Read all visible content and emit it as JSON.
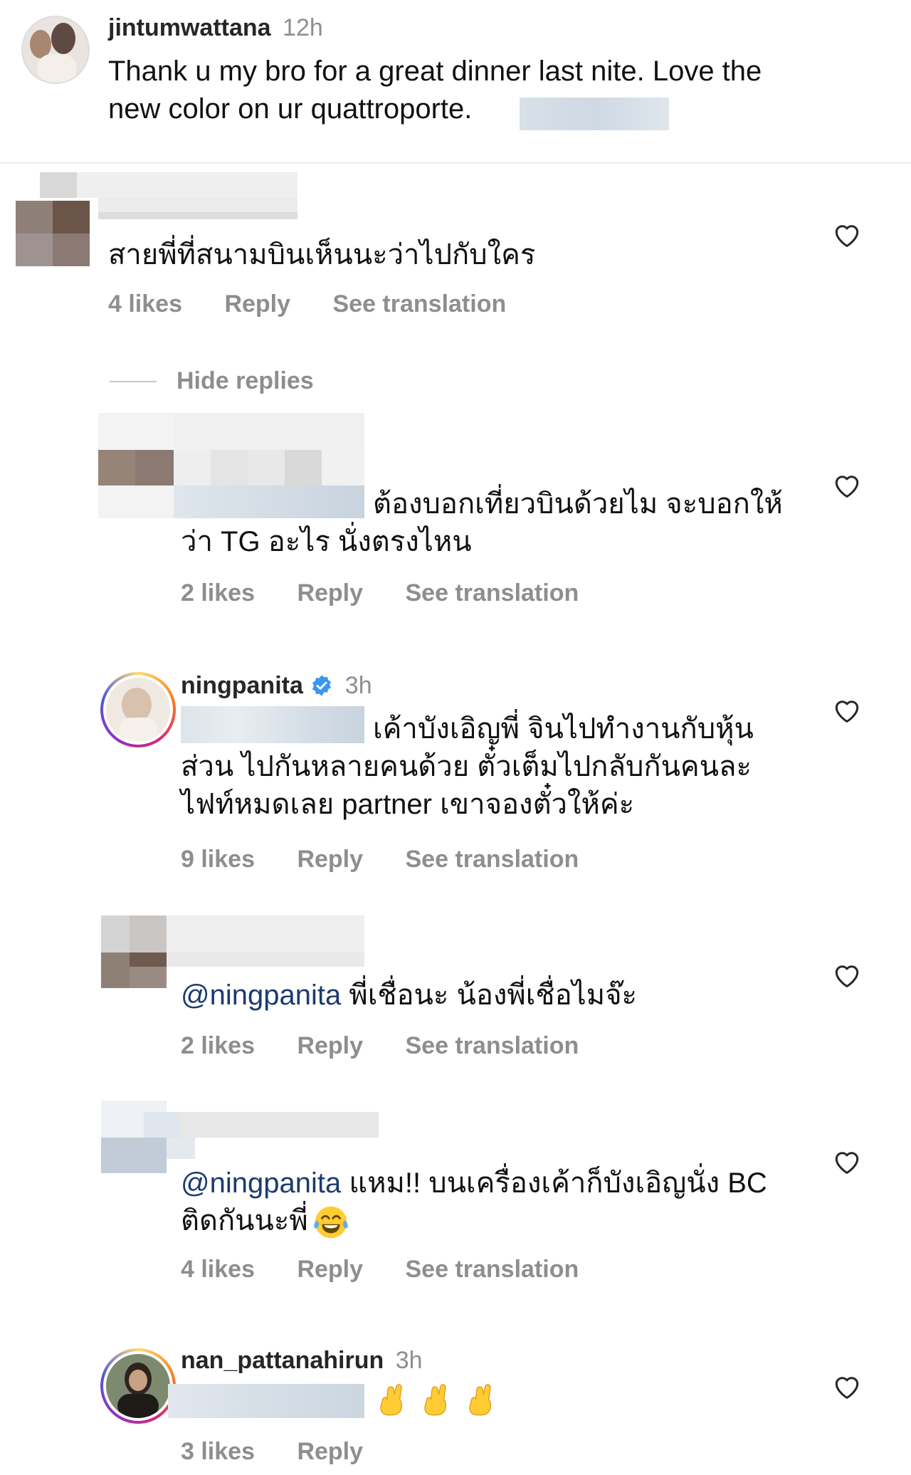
{
  "post": {
    "username": "jintumwattana",
    "time": "12h",
    "caption_line1": "Thank u my bro for a great dinner last nite. Love the",
    "caption_line2": "new color on ur quattroporte."
  },
  "comments": [
    {
      "text": "สายพี่ที่สนามบินเห็นนะว่าไปกับใคร",
      "likes": "4 likes",
      "reply": "Reply",
      "translate": "See translation"
    }
  ],
  "hide_replies": "Hide replies",
  "replies": [
    {
      "text_line1": "ต้องบอกเที่ยวบินด้วยไม จะบอกให้",
      "text_line2": "ว่า TG อะไร นั่งตรงไหน",
      "likes": "2 likes",
      "reply": "Reply",
      "translate": "See translation"
    },
    {
      "username": "ningpanita",
      "time": "3h",
      "verified": true,
      "text_line1": "เค้าบังเอิญพี่ จินไปทำงานกับหุ้น",
      "text_line2": "ส่วน ไปกันหลายคนด้วย ตั๋วเต็มไปกลับกันคนละ",
      "text_line3": "ไฟท์หมดเลย partner เขาจองตั๋วให้ค่ะ",
      "likes": "9 likes",
      "reply": "Reply",
      "translate": "See translation"
    },
    {
      "mention": "@ningpanita",
      "text": " พี่เชื่อนะ น้องพี่เชื่อไมจ๊ะ",
      "likes": "2 likes",
      "reply": "Reply",
      "translate": "See translation"
    },
    {
      "mention": "@ningpanita",
      "text_line1": " แหม!! บนเครื่องเค้าก็บังเอิญนั่ง BC",
      "text_line2": "ติดกันนะพี่",
      "emoji": "face-with-tears-of-joy",
      "likes": "4 likes",
      "reply": "Reply",
      "translate": "See translation"
    },
    {
      "username": "nan_pattanahirun",
      "time": "3h",
      "emoji": "crossed-fingers x3",
      "likes": "3 likes",
      "reply": "Reply"
    }
  ],
  "colors": {
    "secondary_text": "#8e8e8e",
    "mention": "#1c3b6f",
    "verified": "#3897f0"
  }
}
